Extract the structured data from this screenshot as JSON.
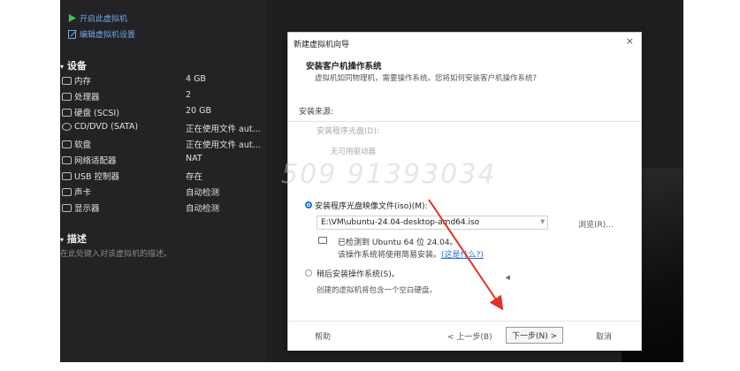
{
  "sidebar": {
    "actions": [
      {
        "label": "开启此虚拟机",
        "icon": "play-icon"
      },
      {
        "label": "编辑虚拟机设置",
        "icon": "edit-settings-icon"
      }
    ],
    "devices_title": "设备",
    "devices": [
      {
        "name": "内存",
        "value": "4 GB",
        "icon": "memory-icon"
      },
      {
        "name": "处理器",
        "value": "2",
        "icon": "processor-icon"
      },
      {
        "name": "硬盘 (SCSI)",
        "value": "20 GB",
        "icon": "hard-disk-icon"
      },
      {
        "name": "CD/DVD (SATA)",
        "value": "正在使用文件 aut...",
        "icon": "cd-dvd-icon"
      },
      {
        "name": "软盘",
        "value": "正在使用文件 aut...",
        "icon": "floppy-icon"
      },
      {
        "name": "网络适配器",
        "value": "NAT",
        "icon": "network-adapter-icon"
      },
      {
        "name": "USB 控制器",
        "value": "存在",
        "icon": "usb-icon"
      },
      {
        "name": "声卡",
        "value": "自动检测",
        "icon": "sound-card-icon"
      },
      {
        "name": "显示器",
        "value": "自动检测",
        "icon": "display-icon"
      }
    ],
    "description_title": "描述",
    "description_hint": "在此处键入对该虚拟机的描述。"
  },
  "dialog": {
    "title": "新建虚拟机向导",
    "close": "×",
    "header_title": "安装客户机操作系统",
    "header_subtitle": "虚拟机如同物理机，需要操作系统。您将如何安装客户机操作系统?",
    "source_label": "安装来源:",
    "disc_option": "安装程序光盘(D):",
    "disc_value": "无可用驱动器",
    "iso_option": "安装程序光盘映像文件(iso)(M):",
    "iso_path": "E:\\VM\\ubuntu-24.04-desktop-amd64.iso",
    "browse": "浏览(R)...",
    "detected": "已检测到 Ubuntu 64 位 24.04。",
    "easy_install": "该操作系统将使用简易安装。",
    "easy_link": "(这是什么?)",
    "later_option": "稍后安装操作系统(S)。",
    "later_desc": "创建的虚拟机将包含一个空白硬盘。",
    "help": "帮助",
    "back": "< 上一步(B)",
    "next": "下一步(N) >",
    "cancel": "取消"
  },
  "watermark": "509 91393034",
  "colors": {
    "accent": "#1f6fd8",
    "arrow": "#e53027",
    "sidebar_bg": "#232325"
  }
}
